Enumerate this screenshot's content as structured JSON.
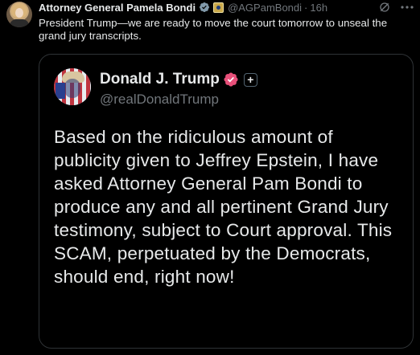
{
  "post": {
    "author_name": "Attorney General Pamela Bondi",
    "handle": "@AGPamBondi",
    "separator": "·",
    "time": "16h",
    "text": "President Trump—we are ready to move the court tomorrow to unseal the grand jury transcripts."
  },
  "quoted": {
    "author_name": "Donald J. Trump",
    "handle": "@realDonaldTrump",
    "plus_symbol": "+",
    "text": "Based on the ridiculous amount of publicity given to Jeffrey Epstein, I have asked Attorney General Pam Bondi to produce any and all pertinent Grand Jury testimony, subject to Court approval. This SCAM, perpetuated by the Democrats, should end, right now!"
  },
  "icons": {
    "gray_badge": "gray-checkmark-icon",
    "seal": "government-seal-icon",
    "grok": "grok-icon",
    "more": "more-options-icon",
    "pink_badge": "verified-pink-icon"
  },
  "colors": {
    "background": "#000000",
    "text": "#e7e9ea",
    "muted": "#71767b",
    "border": "#2f3336",
    "gray_badge": "#829aab",
    "verified_pink": "#e8507a"
  }
}
